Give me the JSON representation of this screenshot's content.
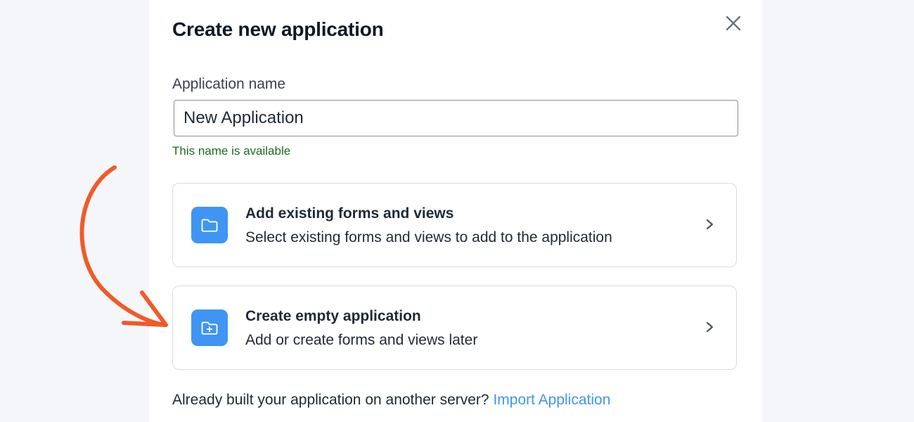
{
  "dialog": {
    "title": "Create new application",
    "close_icon": "close-icon"
  },
  "name_field": {
    "label": "Application name",
    "value": "New Application",
    "hint": "This name is available",
    "hint_color": "#1d6a1f"
  },
  "options": [
    {
      "title": "Add existing forms and views",
      "description": "Select existing forms and views to add to the application",
      "icon": "folder-icon"
    },
    {
      "title": "Create empty application",
      "description": "Add or create forms and views later",
      "icon": "folder-plus-icon"
    }
  ],
  "footer": {
    "text": "Already built your application on another server?",
    "link_text": "Import Application"
  },
  "colors": {
    "accent": "#3f95f4",
    "annotation_arrow": "#f05a28"
  }
}
